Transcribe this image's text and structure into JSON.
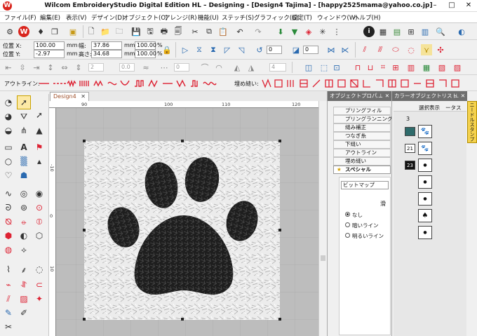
{
  "window": {
    "title": "Wilcom EmbroideryStudio Digital Edition HL – Designing - [Design4         Tajima] - [happy2525mama@yahoo.co.jp]",
    "app_icon": "W",
    "minimize": "–",
    "maximize": "□",
    "close": "✕"
  },
  "menu": [
    "ファイル(F)",
    "編集(E)",
    "表示(V)",
    "デザイン(D)",
    "オブジェクト(O)",
    "アレンジ(R)",
    "機能(U)",
    "ステッチ(S)",
    "グラフィック(G)",
    "設定(T)",
    "ウィンドウ(W)",
    "ヘルプ(H)"
  ],
  "properties": {
    "pos_x_label": "位置 X:",
    "pos_x": "100.00",
    "pos_x_unit": "mm",
    "pos_y_label": "位置 Y:",
    "pos_y": "-2.97",
    "pos_y_unit": "mm",
    "width_label": "幅:",
    "width": "37.86",
    "width_unit": "mm",
    "height_label": "高さ:",
    "height": "34.68",
    "height_unit": "mm",
    "scale_w": "100.00",
    "scale_w_unit": "%",
    "scale_h": "100.00",
    "scale_h_unit": "%",
    "rotation": "0",
    "slant": "0",
    "row_count": "2",
    "spacing": "0.0",
    "angle_a": "0",
    "angle_b": "4"
  },
  "outline_bar": {
    "outline_label": "アウトライン:",
    "fill_label": "埋め縫い:"
  },
  "document_tab": {
    "label": "Design4",
    "close": "✕"
  },
  "ruler": {
    "h_ticks": [
      "90",
      "100",
      "110",
      "120"
    ],
    "v_ticks": [
      "-10",
      "0",
      "10"
    ]
  },
  "object_properties": {
    "header": "オブジェクトプロパ...",
    "pin": "⊥",
    "close": "✕",
    "tabs": [
      "プリングフィル",
      "プリングランニング",
      "縫み補正",
      "つなぎ糸",
      "下縫い",
      "アウトライン",
      "埋め縫い",
      "スペシャル"
    ],
    "dropdown_value": "ビットマップ",
    "smooth_label": "滑",
    "options": [
      "なし",
      "暗いライン",
      "明るいライン"
    ],
    "selected_option": "なし"
  },
  "color_object_list": {
    "header": "カラーオブジェクトリスト",
    "pin": "⊥",
    "close": "✕",
    "view_label": "選択表示",
    "extra_label": "ータス",
    "group_count": "3",
    "items": [
      "",
      "21",
      "23",
      "",
      "",
      "",
      ""
    ],
    "side_tab": "ニードルスタンプ"
  },
  "colors": {
    "accent": "#0078d7",
    "stitch_dark": "#1a1a1a",
    "stitch_light": "#f2f2f2",
    "brand_red": "#d9251d"
  },
  "icons": {
    "toolbar1": [
      "letter-w-icon",
      "balloon-icon",
      "copy-icon",
      "paste-icon",
      "new-file-icon",
      "open-folder-icon",
      "save-icon",
      "save-as-icon",
      "print-icon",
      "print-preview-icon",
      "cut-icon",
      "copy2-icon",
      "paste2-icon",
      "undo-icon",
      "redo-icon",
      "needle-icon",
      "thread-icon",
      "color-icon",
      "stitch-icon",
      "info-icon",
      "film-icon",
      "grid-icon",
      "arrange-icon",
      "zoom-icon",
      "globe-icon"
    ]
  }
}
